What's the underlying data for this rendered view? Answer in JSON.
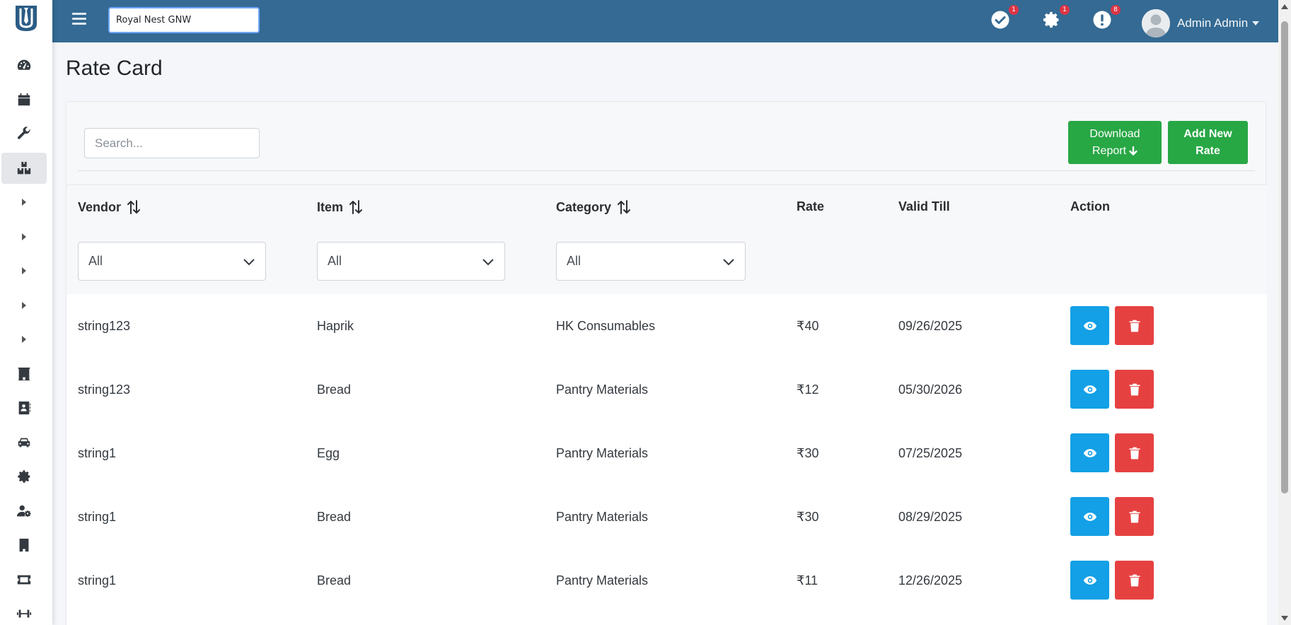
{
  "header": {
    "property_value": "Royal Nest GNW",
    "notifications": [
      {
        "icon": "check-circle-icon",
        "count": "1"
      },
      {
        "icon": "gear-icon",
        "count": "1"
      },
      {
        "icon": "alert-icon",
        "count": "8"
      }
    ],
    "user_name": "Admin Admin"
  },
  "sidebar": {
    "items": [
      {
        "icon": "dashboard-icon"
      },
      {
        "icon": "calendar-icon"
      },
      {
        "icon": "wrench-icon"
      },
      {
        "icon": "boxes-icon",
        "active": true
      },
      {
        "icon": "caret-right-icon"
      },
      {
        "icon": "caret-right-icon"
      },
      {
        "icon": "caret-right-icon"
      },
      {
        "icon": "caret-right-icon"
      },
      {
        "icon": "caret-right-icon"
      },
      {
        "icon": "hotel-icon"
      },
      {
        "icon": "contact-book-icon"
      },
      {
        "icon": "car-icon"
      },
      {
        "icon": "gear-icon"
      },
      {
        "icon": "user-gear-icon"
      },
      {
        "icon": "building-icon"
      },
      {
        "icon": "ticket-icon"
      },
      {
        "icon": "dumbbell-icon"
      }
    ]
  },
  "page": {
    "title": "Rate Card"
  },
  "toolbar": {
    "search_placeholder": "Search...",
    "download_line1": "Download",
    "download_line2": "Report",
    "add_line1": "Add New",
    "add_line2": "Rate"
  },
  "table": {
    "headers": {
      "vendor": "Vendor",
      "item": "Item",
      "category": "Category",
      "rate": "Rate",
      "valid_till": "Valid Till",
      "action": "Action"
    },
    "filters": {
      "vendor": "All",
      "item": "All",
      "category": "All"
    },
    "rows": [
      {
        "vendor": "string123",
        "item": "Haprik",
        "category": "HK Consumables",
        "rate": "₹40",
        "valid_till": "09/26/2025"
      },
      {
        "vendor": "string123",
        "item": "Bread",
        "category": "Pantry Materials",
        "rate": "₹12",
        "valid_till": "05/30/2026"
      },
      {
        "vendor": "string1",
        "item": "Egg",
        "category": "Pantry Materials",
        "rate": "₹30",
        "valid_till": "07/25/2025"
      },
      {
        "vendor": "string1",
        "item": "Bread",
        "category": "Pantry Materials",
        "rate": "₹30",
        "valid_till": "08/29/2025"
      },
      {
        "vendor": "string1",
        "item": "Bread",
        "category": "Pantry Materials",
        "rate": "₹11",
        "valid_till": "12/26/2025"
      }
    ]
  },
  "colors": {
    "topbar": "#346a93",
    "primary_green": "#28a745",
    "view_button": "#13a0e6",
    "delete_button": "#e64141",
    "badge": "#dc3545"
  }
}
